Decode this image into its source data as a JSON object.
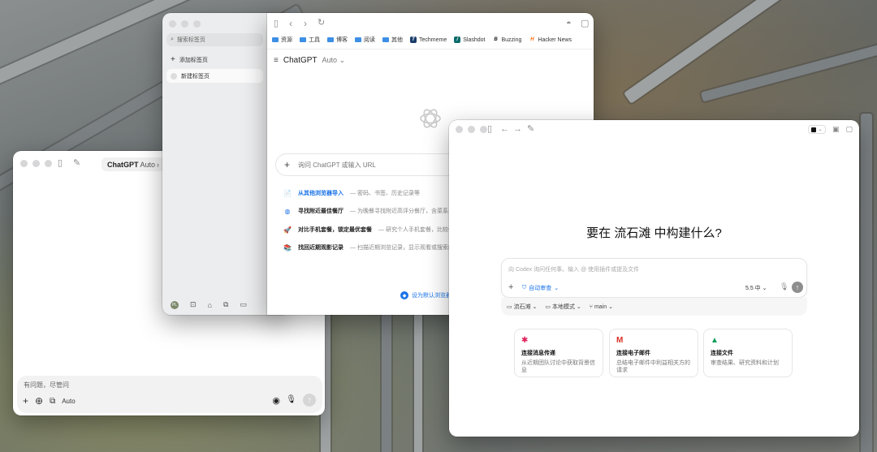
{
  "windowA": {
    "chip_label": "ChatGPT",
    "chip_model": "Auto",
    "composer_placeholder": "有问题，尽管问",
    "auto_label": "Auto"
  },
  "sidebar": {
    "search_placeholder": "搜索标签页",
    "items": [
      {
        "label": "添加标签页",
        "icon": "plus-icon"
      },
      {
        "label": "新建标签页",
        "icon": "globe-icon"
      }
    ],
    "avatar_text": "PL"
  },
  "browser": {
    "bookmarks": [
      {
        "label": "资源",
        "icon": "folder-icon"
      },
      {
        "label": "工具",
        "icon": "folder-icon"
      },
      {
        "label": "博客",
        "icon": "folder-icon"
      },
      {
        "label": "阅读",
        "icon": "folder-icon"
      },
      {
        "label": "其他",
        "icon": "folder-icon"
      },
      {
        "label": "Techmeme",
        "icon": "techmeme-icon"
      },
      {
        "label": "Slashdot",
        "icon": "slashdot-icon"
      },
      {
        "label": "Buzzing",
        "icon": "buzzing-icon"
      },
      {
        "label": "Hacker News",
        "icon": "hackernews-icon"
      }
    ],
    "title": "ChatGPT",
    "title_model": "Auto",
    "omnibox_placeholder": "询问 ChatGPT 或输入 URL",
    "suggestions": [
      {
        "title": "从其他浏览器导入",
        "desc": "— 密码、书签、历史记录等",
        "highlight": true
      },
      {
        "title": "寻找附近最佳餐厅",
        "desc": "— 为晚餐寻找附近高评分餐厅，含菜系与",
        "highlight": false
      },
      {
        "title": "对比手机套餐，锁定最优套餐",
        "desc": "— 研究个人手机套餐，比较价",
        "highlight": false
      },
      {
        "title": "找回近期观影记录",
        "desc": "— 扫描近期浏览记录，显示观看或搜索的",
        "highlight": false
      }
    ],
    "default_browser_label": "设为默认浏览器"
  },
  "codex": {
    "heading": "要在 流石滩 中构建什么?",
    "input_placeholder": "向 Codex 询问任何事。输入 @ 使用插件或提及文件",
    "approval_label": "自动审查",
    "model_label": "5.5 中",
    "meta": {
      "project": "流石滩",
      "mode": "本地模式",
      "branch": "main"
    },
    "cards": [
      {
        "title": "连接消息传递",
        "desc": "从近期团队讨论中获取背景信息",
        "icon": "slack-icon"
      },
      {
        "title": "连接电子邮件",
        "desc": "总结电子邮件中利益相关方的请求",
        "icon": "gmail-icon"
      },
      {
        "title": "连接文件",
        "desc": "审查结果、研究资料和计划",
        "icon": "drive-icon"
      }
    ]
  },
  "colors": {
    "accent_blue": "#1a73e8",
    "folder_blue": "#3d8fe6",
    "techmeme": "#1b3c6b",
    "slashdot": "#0a6b6b",
    "hackernews": "#ff6600"
  }
}
